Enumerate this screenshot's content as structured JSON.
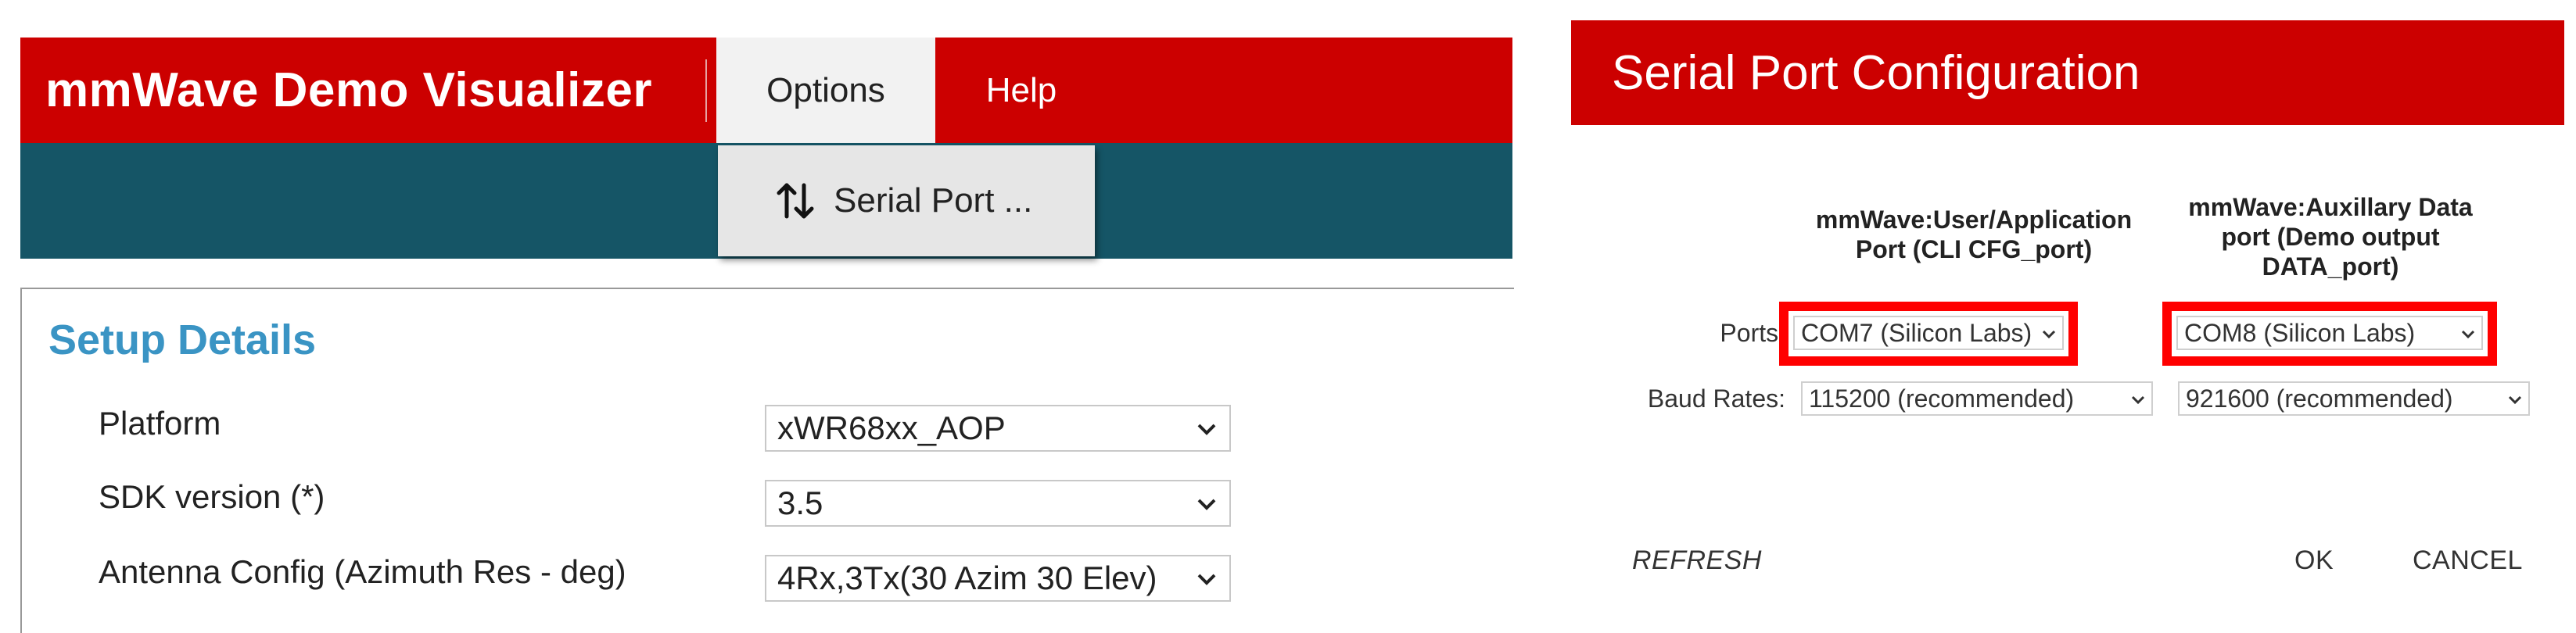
{
  "visualizer": {
    "app_title": "mmWave Demo Visualizer",
    "tabs": {
      "options": "Options",
      "help": "Help"
    },
    "menu": {
      "serial_port": "Serial Port ...",
      "icon": "up-down-arrows-icon"
    },
    "setup": {
      "title": "Setup Details",
      "rows": [
        {
          "label": "Platform",
          "value": "xWR68xx_AOP"
        },
        {
          "label": "SDK version (*)",
          "value": "3.5"
        },
        {
          "label": "Antenna Config (Azimuth Res - deg)",
          "value": "4Rx,3Tx(30 Azim 30 Elev)"
        }
      ]
    },
    "colors": {
      "brand_red": "#cc0000",
      "teal": "#155566",
      "accent_blue": "#3a94c4"
    }
  },
  "dialog": {
    "title": "Serial Port Configuration",
    "col1_header": "mmWave:User/Application\nPort (CLI CFG_port)",
    "col2_header": "mmWave:Auxillary Data\nport (Demo output\nDATA_port)",
    "ports_label": "Ports:",
    "baud_label": "Baud Rates:",
    "port1": "COM7 (Silicon Labs)",
    "port2": "COM8 (Silicon Labs)",
    "baud1": "115200 (recommended)",
    "baud2": "921600 (recommended)",
    "refresh": "REFRESH",
    "ok": "OK",
    "cancel": "CANCEL",
    "highlight_color": "#ff0000"
  }
}
